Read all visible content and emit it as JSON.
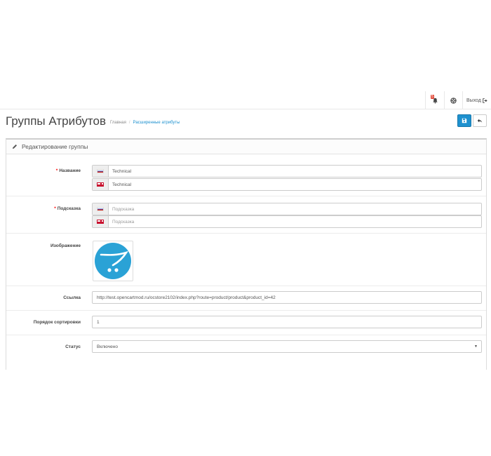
{
  "topbar": {
    "notification_count": "5",
    "logout_label": "Выход"
  },
  "header": {
    "title": "Группы Атрибутов",
    "breadcrumb": [
      "Главная",
      "Расширенные атрибуты"
    ]
  },
  "panel": {
    "heading": "Редактирование группы"
  },
  "form": {
    "name": {
      "label": "Название",
      "values": [
        {
          "flag": "ru",
          "value": "Technical"
        },
        {
          "flag": "en",
          "value": "Technical"
        }
      ]
    },
    "hint": {
      "label": "Подсказка",
      "placeholders": [
        {
          "flag": "ru",
          "placeholder": "Подсказка"
        },
        {
          "flag": "en",
          "placeholder": "Подсказка"
        }
      ]
    },
    "image": {
      "label": "Изображение",
      "icon": "opencart-cart-logo"
    },
    "link": {
      "label": "Ссылка",
      "value": "http://test.opencartmod.ru/ocstore2102/index.php?route=product/product&product_id=42"
    },
    "sort_order": {
      "label": "Порядок сортировки",
      "value": "1"
    },
    "status": {
      "label": "Статус",
      "value": "Включено"
    }
  },
  "colors": {
    "primary": "#1e91cf",
    "required": "#ff0000",
    "badge": "#e34c3c"
  }
}
